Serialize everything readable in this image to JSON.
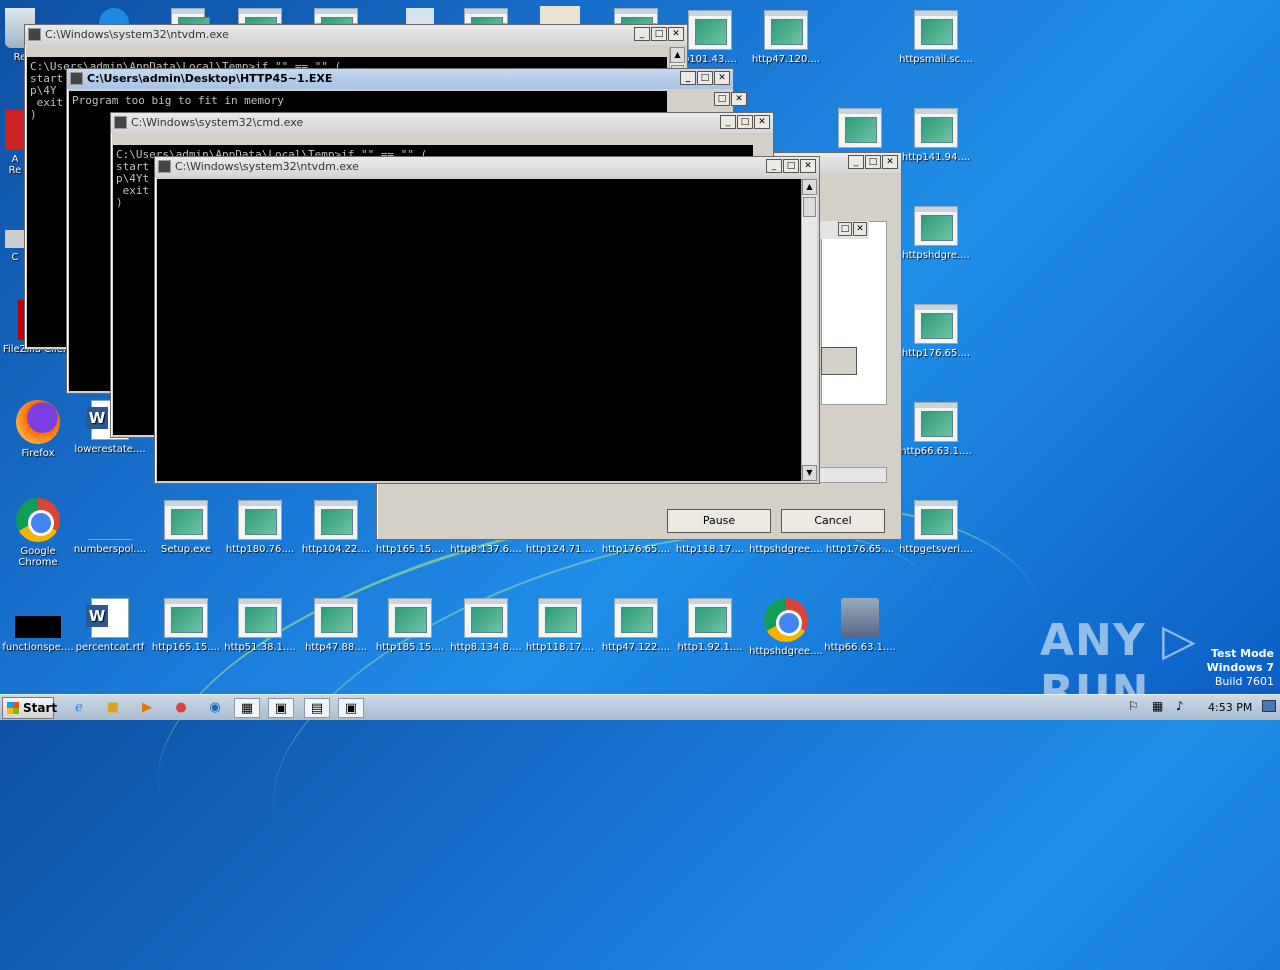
{
  "desktop": {
    "col_left": [
      {
        "label": "Re",
        "kind": "blank"
      },
      {
        "label": "FileZilla Client",
        "kind": "fz"
      },
      {
        "label": "Firefox",
        "kind": "firefox"
      },
      {
        "label": "Google Chrome",
        "kind": "chrome"
      },
      {
        "label": "functionspe....",
        "kind": "black"
      }
    ],
    "top_row": [
      {
        "label": "http47.120....",
        "kind": "exe"
      },
      {
        "label": "httpsmail.sc....",
        "kind": "exe"
      }
    ],
    "right_col": [
      {
        "label": "http141.94....",
        "kind": "exe"
      },
      {
        "label": "httpshdgre....",
        "kind": "exe"
      },
      {
        "label": "http176.65....",
        "kind": "exe"
      },
      {
        "label": "http66.63.1....",
        "kind": "exe"
      },
      {
        "label": "httpgetsveri....",
        "kind": "exe"
      }
    ],
    "row5": [
      {
        "label": "numberspol....",
        "kind": "blank"
      },
      {
        "label": "Setup.exe",
        "kind": "exe"
      },
      {
        "label": "http180.76....",
        "kind": "exe"
      },
      {
        "label": "http104.22....",
        "kind": "exe"
      },
      {
        "label": "http165.15....",
        "kind": "exe"
      },
      {
        "label": "http8.137.6....",
        "kind": "exe"
      },
      {
        "label": "http124.71....",
        "kind": "exe"
      },
      {
        "label": "http176.65....",
        "kind": "exe"
      },
      {
        "label": "http118.17....",
        "kind": "exe"
      },
      {
        "label": "httpshdgree....",
        "kind": "exe"
      },
      {
        "label": "http176.65....",
        "kind": "exe"
      }
    ],
    "row6": [
      {
        "label": "percentcat.rtf",
        "kind": "word"
      },
      {
        "label": "http165.15....",
        "kind": "exe"
      },
      {
        "label": "http51.38.1....",
        "kind": "exe"
      },
      {
        "label": "http47.88....",
        "kind": "exe"
      },
      {
        "label": "http185.15....",
        "kind": "exe"
      },
      {
        "label": "http8.134.8....",
        "kind": "exe"
      },
      {
        "label": "http118.17....",
        "kind": "exe"
      },
      {
        "label": "http47.122....",
        "kind": "exe"
      },
      {
        "label": "http1.92.1....",
        "kind": "exe"
      },
      {
        "label": "httpshdgree....",
        "kind": "chrome"
      },
      {
        "label": "http66.63.1....",
        "kind": "toolbox"
      }
    ],
    "lowerestate_label": "lowerestate....",
    "partial_label_a": "A",
    "partial_label_re": "Re",
    "partial_label_c": "C",
    "partial_label_ip": "p101.43...."
  },
  "windows": {
    "ntvdm1": {
      "title": "C:\\Windows\\system32\\ntvdm.exe",
      "console": "C:\\Users\\admin\\AppData\\Local\\Temp>if \"\" == \"\" (\nstart\np\\4Y\n exit\n)"
    },
    "http45": {
      "title": "C:\\Users\\admin\\Desktop\\HTTP45~1.EXE",
      "console": "Program too big to fit in memory"
    },
    "cmd": {
      "title": "C:\\Windows\\system32\\cmd.exe",
      "console": "C:\\Users\\admin\\AppData\\Local\\Temp>if \"\" == \"\" (\nstart\np\\4Yt\n exit\n)"
    },
    "ntvdm2": {
      "title": "C:\\Windows\\system32\\ntvdm.exe",
      "console": ""
    },
    "installer": {
      "pause_label": "Pause",
      "cancel_label": "Cancel"
    }
  },
  "taskbar": {
    "start_label": "Start",
    "clock": "4:53 PM"
  },
  "watermark": {
    "brand": "ANY ▷ RUN",
    "test_mode": "Test Mode",
    "os": "Windows 7",
    "build": "Build 7601"
  }
}
